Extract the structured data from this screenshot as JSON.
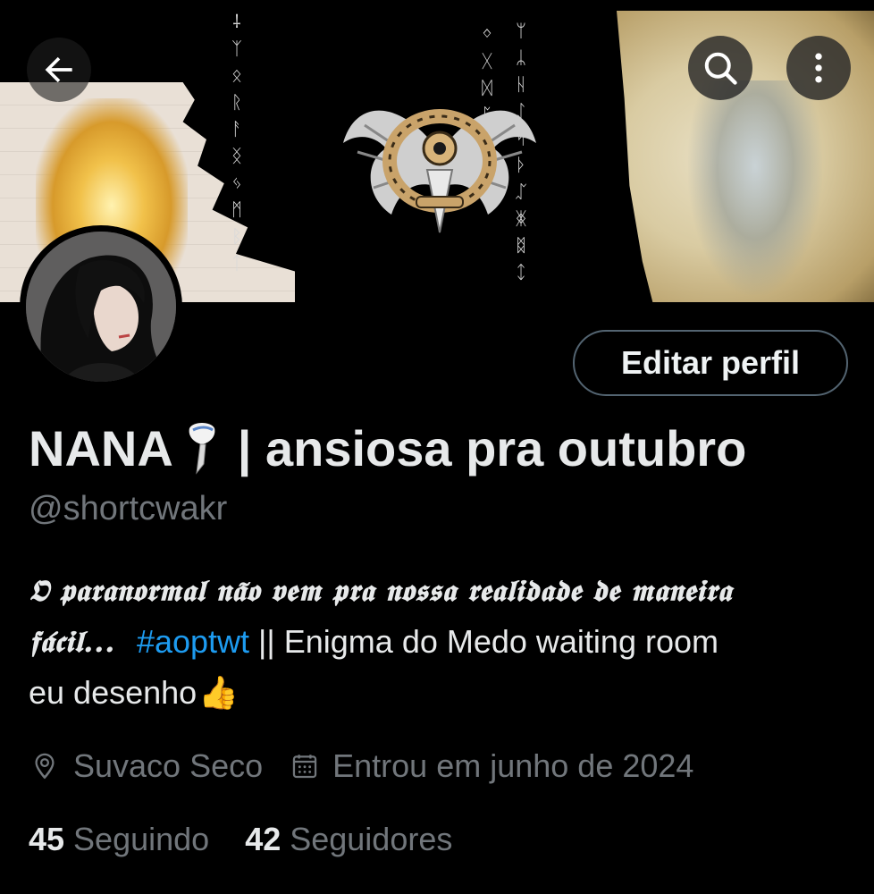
{
  "header": {
    "back_icon": "arrow-left-icon",
    "search_icon": "search-icon",
    "more_icon": "more-vertical-icon"
  },
  "profile": {
    "name_prefix": "NANA",
    "name_emoji_icon": "knife-icon",
    "name_suffix": "| ansiosa pra outubro",
    "handle": "@shortcwakr",
    "edit_button_label": "Editar perfil",
    "bio": {
      "line1": "𝕺 𝖕𝖆𝖗𝖆𝖓𝖔𝖗𝖒𝖆𝖑 𝖓𝖆̃𝖔 𝖛𝖊𝖒 𝖕𝖗𝖆 𝖓𝖔𝖘𝖘𝖆 𝖗𝖊𝖆𝖑𝖎𝖉𝖆𝖉𝖊 𝖉𝖊 𝖒𝖆𝖓𝖊𝖎𝖗𝖆",
      "line2_gothic": "𝖋𝖆́𝖈𝖎𝖑...",
      "hashtag": "#aoptwt",
      "line2_rest": "|| Enigma do Medo waiting room",
      "line3": "eu desenho",
      "line3_emoji": "👍"
    },
    "location": "Suvaco Seco",
    "joined": "Entrou em junho de 2024",
    "following_count": "45",
    "following_label": "Seguindo",
    "followers_count": "42",
    "followers_label": "Seguidores"
  },
  "colors": {
    "background": "#000000",
    "text_primary": "#e7e9ea",
    "text_secondary": "#71767b",
    "link": "#1d9bf0",
    "button_border": "#536471"
  }
}
